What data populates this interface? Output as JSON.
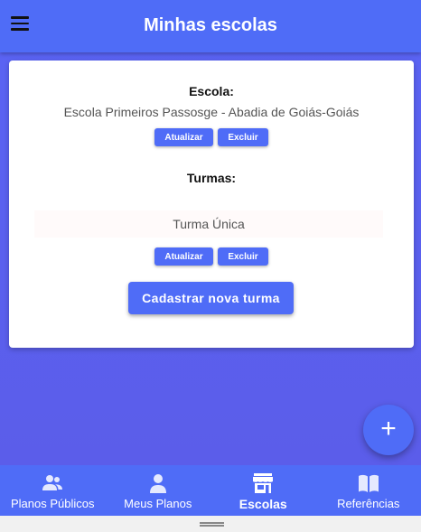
{
  "header": {
    "title": "Minhas escolas",
    "menu_icon": "menu-icon"
  },
  "school": {
    "label": "Escola:",
    "name": "Escola Primeiros Passosge - Abadia de Goiás-Goiás",
    "update_label": "Atualizar",
    "delete_label": "Excluir"
  },
  "classes": {
    "label": "Turmas:",
    "items": [
      {
        "name": "Turma Única",
        "update_label": "Atualizar",
        "delete_label": "Excluir"
      }
    ],
    "add_button_label": "Cadastrar nova turma"
  },
  "fab": {
    "label": "+",
    "icon": "plus-icon"
  },
  "bottom_nav": {
    "items": [
      {
        "label": "Planos Públicos",
        "icon": "people-icon",
        "active": false
      },
      {
        "label": "Meus Planos",
        "icon": "person-icon",
        "active": false
      },
      {
        "label": "Escolas",
        "icon": "store-icon",
        "active": true
      },
      {
        "label": "Referências",
        "icon": "book-icon",
        "active": false
      }
    ]
  },
  "colors": {
    "primary": "#4f6cf7",
    "background": "#5a5ff0",
    "card": "#ffffff"
  }
}
